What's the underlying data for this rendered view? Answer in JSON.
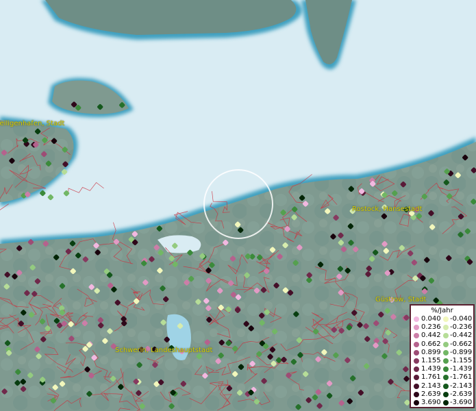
{
  "map": {
    "places": [
      {
        "name": "Heiligenhafen, Stadt"
      },
      {
        "name": "Rostock, Hansestadt"
      },
      {
        "name": "Güstrow, Stadt"
      },
      {
        "name": "Schwerin, Landeshauptstadt"
      }
    ],
    "colors": {
      "sea": "#d9ecf3",
      "land": "#7f9a90",
      "land_far": "#6e8e86",
      "border": "#cc3340",
      "label": "#d8d000"
    }
  },
  "legend": {
    "title": "%/Jahr",
    "positive": [
      {
        "value": "0.040",
        "color": "#f2b8e0"
      },
      {
        "value": "0.236",
        "color": "#e29ac5"
      },
      {
        "value": "0.442",
        "color": "#cc7ea8"
      },
      {
        "value": "0.662",
        "color": "#b5628d"
      },
      {
        "value": "0.899",
        "color": "#9d4c75"
      },
      {
        "value": "1.155",
        "color": "#873a60"
      },
      {
        "value": "1.439",
        "color": "#70294b"
      },
      {
        "value": "1.761",
        "color": "#5a1b38"
      },
      {
        "value": "2.143",
        "color": "#440f28"
      },
      {
        "value": "2.639",
        "color": "#2e0719"
      },
      {
        "value": "3.690",
        "color": "#18030c"
      }
    ],
    "negative": [
      {
        "value": "-0.040",
        "color": "#f2f7bc"
      },
      {
        "value": "-0.236",
        "color": "#d6ecae"
      },
      {
        "value": "-0.442",
        "color": "#b6dd98"
      },
      {
        "value": "-0.662",
        "color": "#94cb80"
      },
      {
        "value": "-0.899",
        "color": "#72b765"
      },
      {
        "value": "-1.155",
        "color": "#55a04f"
      },
      {
        "value": "-1.439",
        "color": "#3b8a3b"
      },
      {
        "value": "-1.761",
        "color": "#26712b"
      },
      {
        "value": "-2.143",
        "color": "#14581c"
      },
      {
        "value": "-2.639",
        "color": "#083e10"
      },
      {
        "value": "-3.690",
        "color": "#022506"
      }
    ]
  }
}
